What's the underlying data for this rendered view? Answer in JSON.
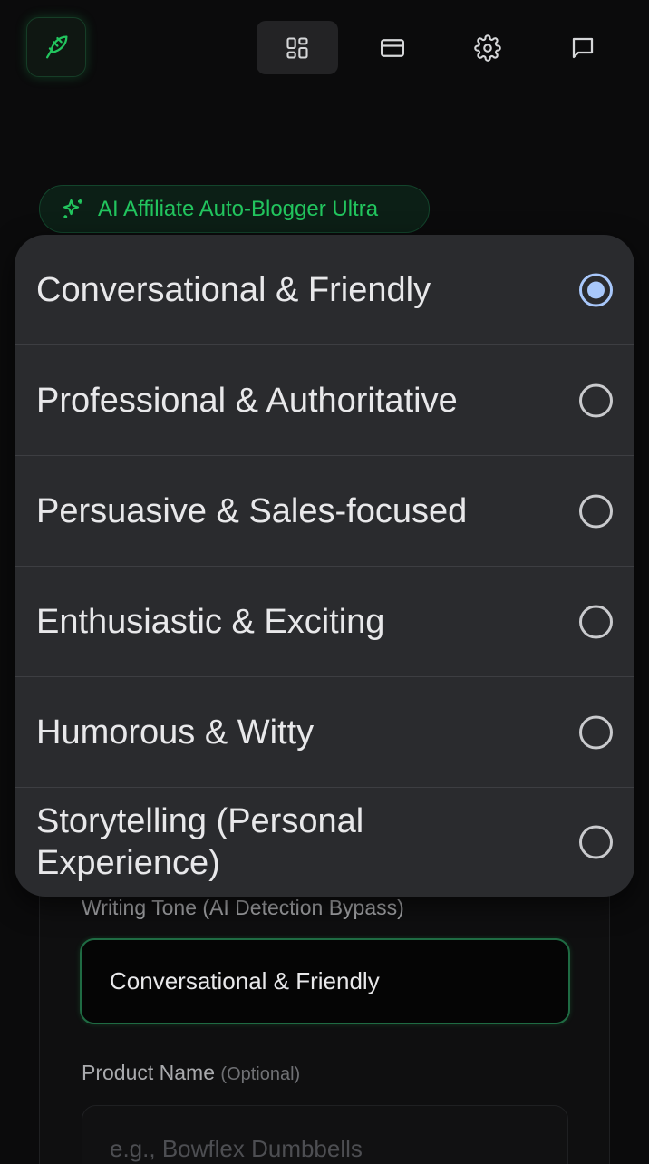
{
  "header": {
    "nav": [
      {
        "icon": "dashboard-icon",
        "active": true
      },
      {
        "icon": "credit-card-icon",
        "active": false
      },
      {
        "icon": "gear-icon",
        "active": false
      },
      {
        "icon": "chat-icon",
        "active": false
      }
    ]
  },
  "badge": {
    "label": "AI Affiliate Auto-Blogger Ultra",
    "icon": "sparkles-icon"
  },
  "form": {
    "tone_label": "Writing Tone (AI Detection Bypass)",
    "tone_value": "Conversational & Friendly",
    "product_label": "Product Name",
    "product_optional": "(Optional)",
    "product_placeholder": "e.g., Bowflex Dumbbells"
  },
  "dropdown": {
    "selected": "Conversational & Friendly",
    "options": [
      {
        "label": "Conversational & Friendly",
        "checked": true
      },
      {
        "label": "Professional & Authoritative",
        "checked": false
      },
      {
        "label": "Persuasive & Sales-focused",
        "checked": false
      },
      {
        "label": "Enthusiastic & Exciting",
        "checked": false
      },
      {
        "label": "Humorous & Witty",
        "checked": false
      },
      {
        "label": "Storytelling (Personal Experience)",
        "checked": false
      }
    ]
  },
  "colors": {
    "accent": "#22c55e",
    "radio_selected": "#a8c7fa",
    "dropdown_bg": "#2a2b2e",
    "page_bg": "#0b0b0c"
  }
}
